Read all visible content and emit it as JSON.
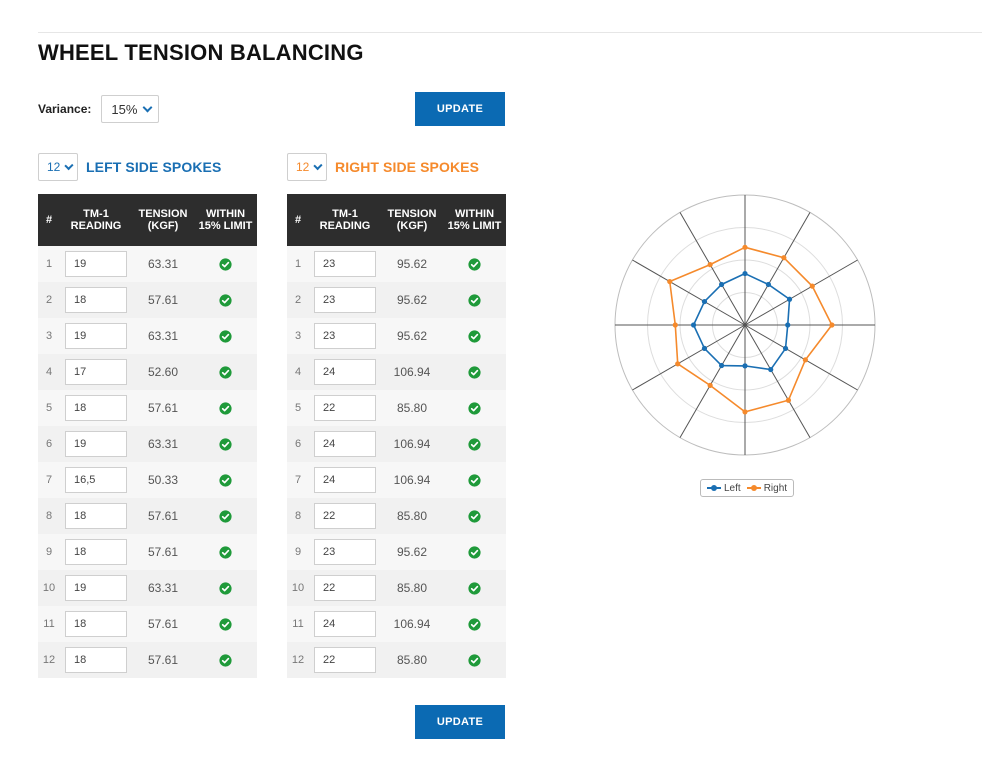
{
  "page": {
    "title": "WHEEL TENSION BALANCING"
  },
  "variance": {
    "label": "Variance:",
    "selected": "15%"
  },
  "buttons": {
    "update_top": "UPDATE",
    "update_bottom": "UPDATE"
  },
  "left": {
    "count": "12",
    "title": "LEFT SIDE SPOKES",
    "color": "#1a6fb3",
    "headers": {
      "num": "#",
      "reading": "TM-1 READING",
      "tension": "TENSION (KGF)",
      "within": "WITHIN 15% LIMIT"
    },
    "rows": [
      {
        "num": "1",
        "reading": "19",
        "tension": "63.31",
        "ok": true
      },
      {
        "num": "2",
        "reading": "18",
        "tension": "57.61",
        "ok": true
      },
      {
        "num": "3",
        "reading": "19",
        "tension": "63.31",
        "ok": true
      },
      {
        "num": "4",
        "reading": "17",
        "tension": "52.60",
        "ok": true
      },
      {
        "num": "5",
        "reading": "18",
        "tension": "57.61",
        "ok": true
      },
      {
        "num": "6",
        "reading": "19",
        "tension": "63.31",
        "ok": true
      },
      {
        "num": "7",
        "reading": "16,5",
        "tension": "50.33",
        "ok": true
      },
      {
        "num": "8",
        "reading": "18",
        "tension": "57.61",
        "ok": true
      },
      {
        "num": "9",
        "reading": "18",
        "tension": "57.61",
        "ok": true
      },
      {
        "num": "10",
        "reading": "19",
        "tension": "63.31",
        "ok": true
      },
      {
        "num": "11",
        "reading": "18",
        "tension": "57.61",
        "ok": true
      },
      {
        "num": "12",
        "reading": "18",
        "tension": "57.61",
        "ok": true
      }
    ]
  },
  "right": {
    "count": "12",
    "title": "RIGHT SIDE SPOKES",
    "color": "#f58a2c",
    "headers": {
      "num": "#",
      "reading": "TM-1 READING",
      "tension": "TENSION (KGF)",
      "within": "WITHIN 15% LIMIT"
    },
    "rows": [
      {
        "num": "1",
        "reading": "23",
        "tension": "95.62",
        "ok": true
      },
      {
        "num": "2",
        "reading": "23",
        "tension": "95.62",
        "ok": true
      },
      {
        "num": "3",
        "reading": "23",
        "tension": "95.62",
        "ok": true
      },
      {
        "num": "4",
        "reading": "24",
        "tension": "106.94",
        "ok": true
      },
      {
        "num": "5",
        "reading": "22",
        "tension": "85.80",
        "ok": true
      },
      {
        "num": "6",
        "reading": "24",
        "tension": "106.94",
        "ok": true
      },
      {
        "num": "7",
        "reading": "24",
        "tension": "106.94",
        "ok": true
      },
      {
        "num": "8",
        "reading": "22",
        "tension": "85.80",
        "ok": true
      },
      {
        "num": "9",
        "reading": "23",
        "tension": "95.62",
        "ok": true
      },
      {
        "num": "10",
        "reading": "22",
        "tension": "85.80",
        "ok": true
      },
      {
        "num": "11",
        "reading": "24",
        "tension": "106.94",
        "ok": true
      },
      {
        "num": "12",
        "reading": "22",
        "tension": "85.80",
        "ok": true
      }
    ]
  },
  "colors": {
    "ok_green": "#1f9a3a",
    "update_blue": "#0b6ab3",
    "header_dark": "#2d2d2d"
  },
  "icons": {
    "ok": "check-circle-icon",
    "dropdown": "chevron-down-icon"
  },
  "chart_data": {
    "type": "radar",
    "categories": [
      "1",
      "2",
      "3",
      "4",
      "5",
      "6",
      "7",
      "8",
      "9",
      "10",
      "11",
      "12"
    ],
    "series": [
      {
        "name": "Left",
        "color": "#1a6fb3",
        "values": [
          63.31,
          57.61,
          63.31,
          52.6,
          57.61,
          63.31,
          50.33,
          57.61,
          57.61,
          63.31,
          57.61,
          57.61
        ]
      },
      {
        "name": "Right",
        "color": "#f58a2c",
        "values": [
          95.62,
          95.62,
          95.62,
          106.94,
          85.8,
          106.94,
          106.94,
          85.8,
          95.62,
          85.8,
          106.94,
          85.8
        ]
      }
    ],
    "rmax": 160,
    "rings": 4,
    "legend": "bottom"
  }
}
